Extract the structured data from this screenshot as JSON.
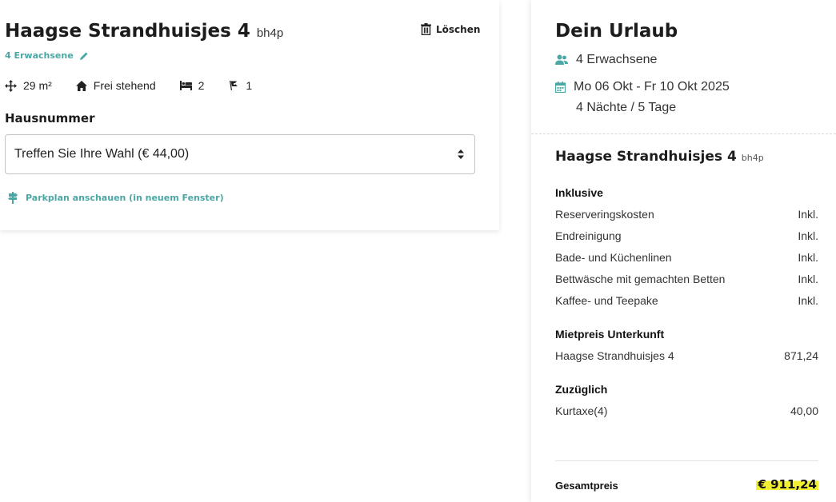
{
  "booking": {
    "title": "Haagse Strandhuisjes 4",
    "code": "bh4p",
    "delete_label": "Löschen",
    "guests_link": "4 Erwachsene",
    "features": {
      "area": "29 m²",
      "type": "Frei stehend",
      "bedrooms": "2",
      "pets": "1"
    },
    "house_number_label": "Hausnummer",
    "house_number_select": "Treffen Sie Ihre Wahl (€ 44,00)",
    "parking_link": "Parkplan anschauen (in neuem Fenster)"
  },
  "summary": {
    "title": "Dein Urlaub",
    "guests": "4 Erwachsene",
    "dates": "Mo 06 Okt - Fr 10 Okt 2025",
    "duration": "4 Nächte / 5 Tage",
    "house_title": "Haagse Strandhuisjes 4",
    "house_code": "bh4p",
    "included_label": "Inklusive",
    "included_items": [
      {
        "label": "Reserveringskosten",
        "value": "Inkl."
      },
      {
        "label": "Endreinigung",
        "value": "Inkl."
      },
      {
        "label": "Bade- und Küchenlinen",
        "value": "Inkl."
      },
      {
        "label": "Bettwäsche mit gemachten Betten",
        "value": "Inkl."
      },
      {
        "label": "Kaffee- und Teepake",
        "value": "Inkl."
      }
    ],
    "rent_label": "Mietpreis Unterkunft",
    "rent_items": [
      {
        "label": "Haagse Strandhuisjes 4",
        "value": "871,24"
      }
    ],
    "extra_label": "Zuzüglich",
    "extra_items": [
      {
        "label": "Kurtaxe(4)",
        "value": "40,00"
      }
    ],
    "total_label": "Gesamtpreis",
    "total_value": "€ 911,24"
  },
  "colors": {
    "accent": "#4aa7a4",
    "highlight": "#f3f032"
  }
}
